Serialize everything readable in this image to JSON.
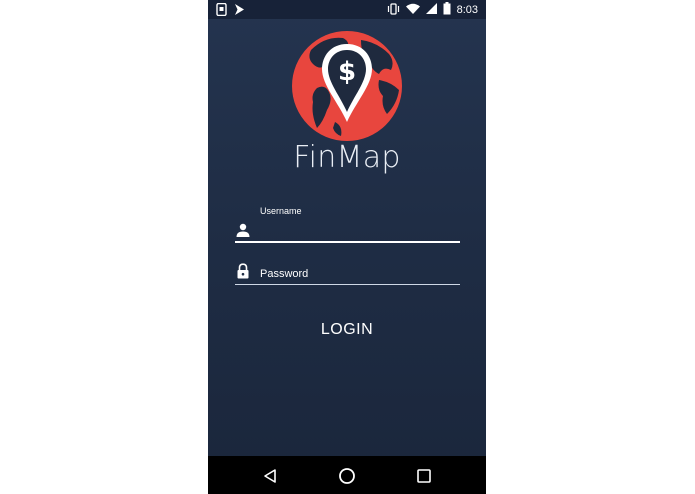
{
  "status_bar": {
    "time": "8:03",
    "left_icons": [
      "screenshot-icon",
      "notification-icon"
    ],
    "right_icons": [
      "vibrate-icon",
      "wifi-icon",
      "signal-icon",
      "battery-icon"
    ]
  },
  "app": {
    "name": "FinMap",
    "logo": "globe-map-pin-dollar-logo",
    "colors": {
      "background": "#1f2d45",
      "logo_red": "#e8463e",
      "text": "#ffffff"
    }
  },
  "form": {
    "username": {
      "label": "Username",
      "value": "",
      "icon": "person-icon"
    },
    "password": {
      "placeholder": "Password",
      "value": "",
      "icon": "lock-icon"
    },
    "login_label": "LOGIN"
  },
  "nav_bar": {
    "buttons": [
      "back-icon",
      "home-icon",
      "recents-icon"
    ]
  }
}
